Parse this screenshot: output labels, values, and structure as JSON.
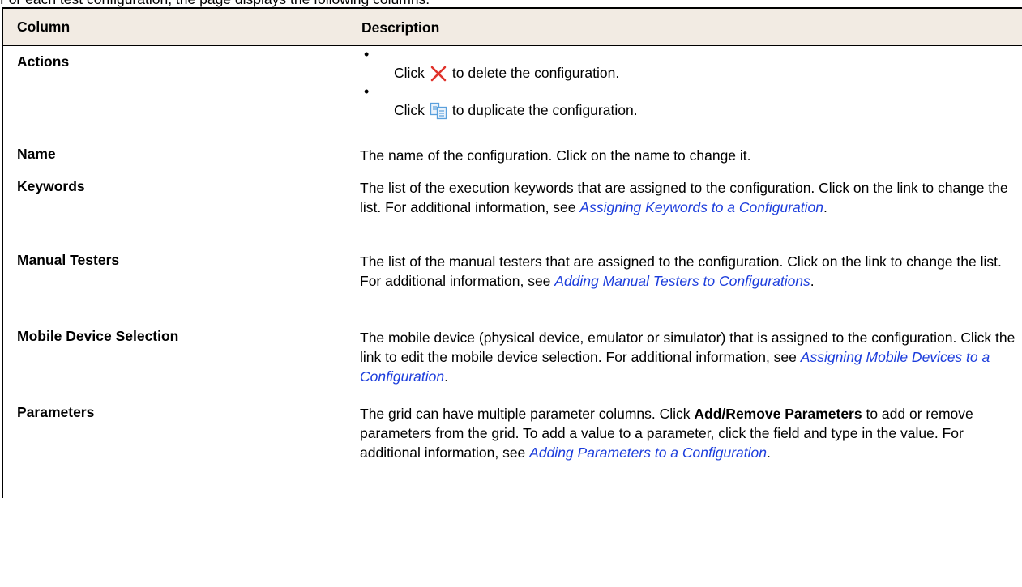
{
  "intro_text": "For each test configuration, the page displays the following columns:",
  "table": {
    "header": {
      "column": "Column",
      "description": "Description"
    },
    "actions": {
      "name": "Actions",
      "bullets": [
        {
          "pre": "Click",
          "icon": "delete-x-icon",
          "post": "to delete the configuration."
        },
        {
          "pre": "Click",
          "icon": "duplicate-icon",
          "post": "to duplicate the configuration."
        }
      ]
    },
    "name_row": {
      "name": "Name",
      "text": "The name of the configuration. Click on the name to change it."
    },
    "keywords": {
      "name": "Keywords",
      "text": "The list of the execution keywords that are assigned to the configuration. Click on the link to change the list. For additional information, see",
      "link": "Assigning Keywords to a Configuration",
      "end": "."
    },
    "manual_testers": {
      "name": "Manual Testers",
      "text": "The list of the manual testers that are assigned to the configuration. Click on the link to change the list. For additional information, see",
      "link": "Adding Manual Testers to Configurations",
      "end": "."
    },
    "mobile": {
      "name": "Mobile Device Selection",
      "text": "The mobile device (physical device, emulator or simulator) that is assigned to the configuration. Click the link to edit the mobile device selection. For additional information, see",
      "link": "Assigning Mobile Devices to a Configuration",
      "end": "."
    },
    "parameters": {
      "name": "Parameters",
      "text_1": "The grid can have multiple parameter columns. Click",
      "bold": "Add/Remove Parameters",
      "text_2": "to add or remove parameters from the grid. To add a value to a parameter, click the field and type in the value. For additional information, see",
      "link": "Adding Parameters to a Configuration",
      "end": "."
    }
  },
  "colors": {
    "header_bg": "#f2ebe3",
    "link": "#1c3ddc",
    "delete_icon": "#e0322b",
    "duplicate_icon": "#5aa0dc"
  }
}
